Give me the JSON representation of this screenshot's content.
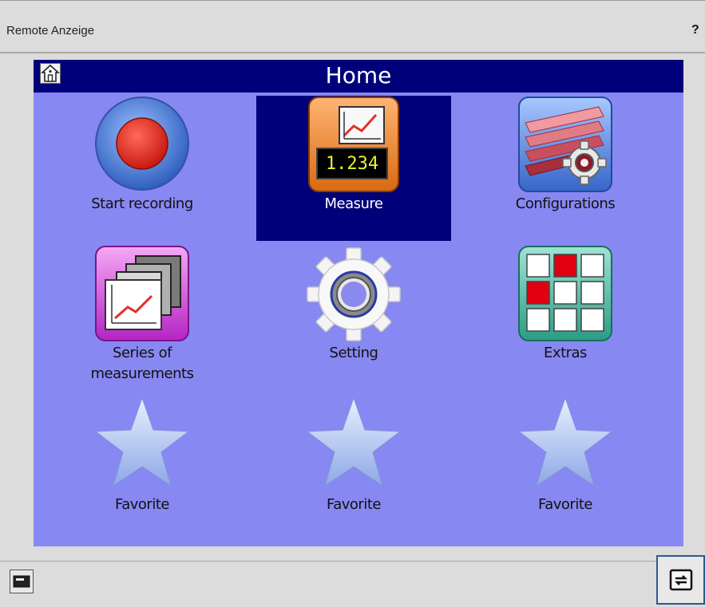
{
  "window": {
    "title": "Remote Anzeige",
    "help_label": "?"
  },
  "screen": {
    "header_title": "Home",
    "tiles": [
      {
        "label": "Start recording",
        "icon": "record-icon",
        "active": false
      },
      {
        "label": "Measure",
        "icon": "measure-icon",
        "active": true,
        "display_value": "1.234"
      },
      {
        "label": "Configurations",
        "icon": "configurations-icon",
        "active": false
      },
      {
        "label_line1": "Series of",
        "label_line2": "measurements",
        "icon": "series-icon",
        "active": false
      },
      {
        "label": "Setting",
        "icon": "gear-icon",
        "active": false
      },
      {
        "label": "Extras",
        "icon": "extras-grid-icon",
        "active": false
      },
      {
        "label": "Favorite",
        "icon": "star-icon",
        "active": false
      },
      {
        "label": "Favorite",
        "icon": "star-icon",
        "active": false
      },
      {
        "label": "Favorite",
        "icon": "star-icon",
        "active": false
      }
    ]
  },
  "colors": {
    "screen_bg": "#8888f2",
    "header_bg": "#00007a",
    "active_tile_bg": "#00007a",
    "frame_bg": "#dcdcdc"
  },
  "bottom_bar": {
    "left_button_icon": "display-icon",
    "right_button_icon": "refresh-icon"
  }
}
